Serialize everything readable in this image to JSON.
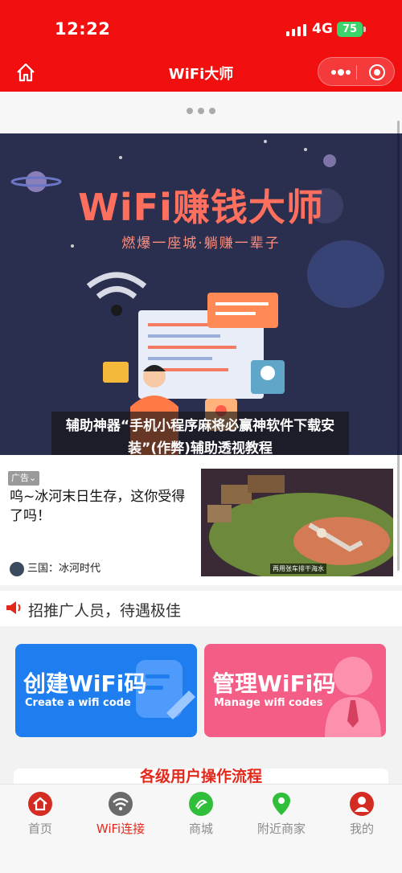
{
  "status_bar": {
    "time": "12:22",
    "network": "4G",
    "battery": "75"
  },
  "navbar": {
    "title": "WiFi大师"
  },
  "banner": {
    "title": "WiFi赚钱大师",
    "subtitle": "燃爆一座城·躺赚一辈子",
    "overlay_caption": "辅助神器“手机小程序麻将必赢神软件下载安装”(作弊)辅助透视教程"
  },
  "ad": {
    "tag": "广告⌄",
    "text": "呜~冰河末日生存，这你受得了吗！",
    "source": "三国：冰河时代",
    "image_caption": "再用张车排干海水"
  },
  "recruit": {
    "text": "招推广人员，待遇极佳"
  },
  "cards": [
    {
      "title": "创建WiFi码",
      "subtitle": "Create a wifi code",
      "color": "#1e7ef0"
    },
    {
      "title": "管理WiFi码",
      "subtitle": "Manage wifi codes",
      "color": "#f35d86"
    }
  ],
  "process": {
    "title": "各级用户操作流程"
  },
  "tabbar": {
    "items": [
      {
        "label": "首页",
        "icon": "home-icon",
        "active": false
      },
      {
        "label": "WiFi连接",
        "icon": "wifi-icon",
        "active": true
      },
      {
        "label": "商城",
        "icon": "shop-icon",
        "active": false
      },
      {
        "label": "附近商家",
        "icon": "location-icon",
        "active": false
      },
      {
        "label": "我的",
        "icon": "profile-icon",
        "active": false
      }
    ]
  },
  "colors": {
    "brand_red": "#f20f0f",
    "accent_red": "#e3291c",
    "banner_bg": "#2b2f4f"
  }
}
